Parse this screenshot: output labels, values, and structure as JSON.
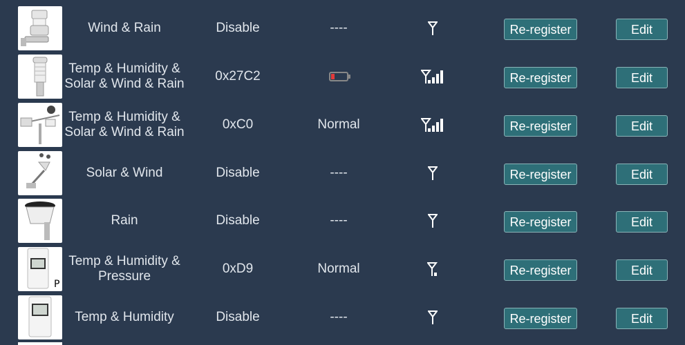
{
  "colors": {
    "background": "#2b3a4f",
    "button": "#2e6f78",
    "text": "#e1e6ec",
    "battery_low": "#e33a3a"
  },
  "sensors": [
    {
      "name": "Wind & Rain",
      "id": "Disable",
      "battery": "----",
      "battery_icon": null,
      "signal_bars": 0,
      "signal_icon": "antenna-icon",
      "image": "wind-rain-sensor",
      "reregister": "Re-register",
      "edit": "Edit"
    },
    {
      "name": "Temp & Humidity & Solar & Wind & Rain",
      "id": "0x27C2",
      "battery": "",
      "battery_icon": "battery-low-icon",
      "battery_level": 0.2,
      "signal_bars": 4,
      "signal_icon": "antenna-signal-icon",
      "image": "ultrasonic-sensor",
      "reregister": "Re-register",
      "edit": "Edit"
    },
    {
      "name": "Temp & Humidity & Solar & Wind & Rain",
      "id": "0xC0",
      "battery": "Normal",
      "battery_icon": null,
      "signal_bars": 4,
      "signal_icon": "antenna-signal-icon",
      "image": "7in1-sensor",
      "reregister": "Re-register",
      "edit": "Edit"
    },
    {
      "name": "Solar & Wind",
      "id": "Disable",
      "battery": "----",
      "battery_icon": null,
      "signal_bars": 0,
      "signal_icon": "antenna-icon",
      "image": "solar-wind-sensor",
      "reregister": "Re-register",
      "edit": "Edit"
    },
    {
      "name": "Rain",
      "id": "Disable",
      "battery": "----",
      "battery_icon": null,
      "signal_bars": 0,
      "signal_icon": "antenna-icon",
      "image": "rain-gauge",
      "reregister": "Re-register",
      "edit": "Edit"
    },
    {
      "name": "Temp & Humidity & Pressure",
      "id": "0xD9",
      "battery": "Normal",
      "battery_icon": null,
      "signal_bars": 1,
      "signal_icon": "antenna-signal-icon",
      "image": "thp-sensor",
      "image_label": "P",
      "reregister": "Re-register",
      "edit": "Edit"
    },
    {
      "name": "Temp & Humidity",
      "id": "Disable",
      "battery": "----",
      "battery_icon": null,
      "signal_bars": 0,
      "signal_icon": "antenna-icon",
      "image": "th-sensor",
      "reregister": "Re-register",
      "edit": "Edit"
    }
  ]
}
